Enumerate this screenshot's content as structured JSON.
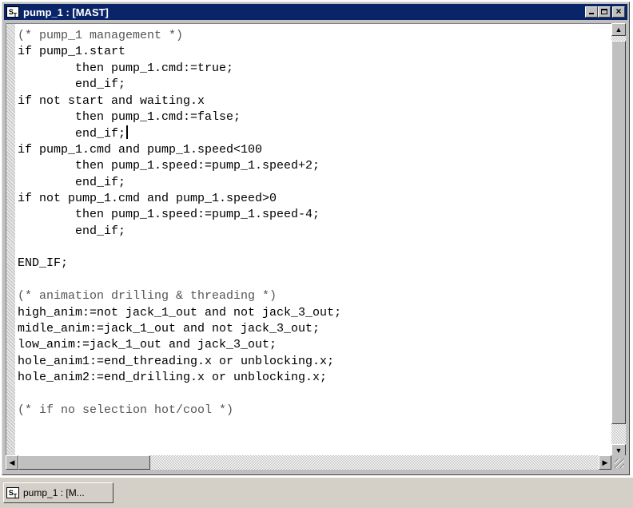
{
  "window": {
    "title": "pump_1 : [MAST]",
    "icon_letter": "S",
    "icon_sub": "T"
  },
  "titlebar_buttons": {
    "minimize": "minimize-icon",
    "maximize": "maximize-icon",
    "close": "×"
  },
  "code_lines": [
    {
      "text": "(* pump_1 management *)",
      "type": "comment"
    },
    {
      "text": "if pump_1.start",
      "type": "code"
    },
    {
      "text": "        then pump_1.cmd:=true;",
      "type": "code"
    },
    {
      "text": "        end_if;",
      "type": "code"
    },
    {
      "text": "if not start and waiting.x",
      "type": "code"
    },
    {
      "text": "        then pump_1.cmd:=false;",
      "type": "code"
    },
    {
      "text": "        end_if;",
      "type": "code",
      "caret": true
    },
    {
      "text": "if pump_1.cmd and pump_1.speed<100",
      "type": "code"
    },
    {
      "text": "        then pump_1.speed:=pump_1.speed+2;",
      "type": "code"
    },
    {
      "text": "        end_if;",
      "type": "code"
    },
    {
      "text": "if not pump_1.cmd and pump_1.speed>0",
      "type": "code"
    },
    {
      "text": "        then pump_1.speed:=pump_1.speed-4;",
      "type": "code"
    },
    {
      "text": "        end_if;",
      "type": "code"
    },
    {
      "text": "",
      "type": "code"
    },
    {
      "text": "END_IF;",
      "type": "code"
    },
    {
      "text": "",
      "type": "code"
    },
    {
      "text": "(* animation drilling & threading *)",
      "type": "comment"
    },
    {
      "text": "high_anim:=not jack_1_out and not jack_3_out;",
      "type": "code"
    },
    {
      "text": "midle_anim:=jack_1_out and not jack_3_out;",
      "type": "code"
    },
    {
      "text": "low_anim:=jack_1_out and jack_3_out;",
      "type": "code"
    },
    {
      "text": "hole_anim1:=end_threading.x or unblocking.x;",
      "type": "code"
    },
    {
      "text": "hole_anim2:=end_drilling.x or unblocking.x;",
      "type": "code"
    },
    {
      "text": "",
      "type": "code"
    },
    {
      "text": "(* if no selection hot/cool *)",
      "type": "comment"
    }
  ],
  "scrollbars": {
    "up_arrow": "▲",
    "down_arrow": "▼",
    "left_arrow": "◀",
    "right_arrow": "▶"
  },
  "taskbar": {
    "button_label": "pump_1 : [M...",
    "icon_letter": "S",
    "icon_sub": "T"
  }
}
